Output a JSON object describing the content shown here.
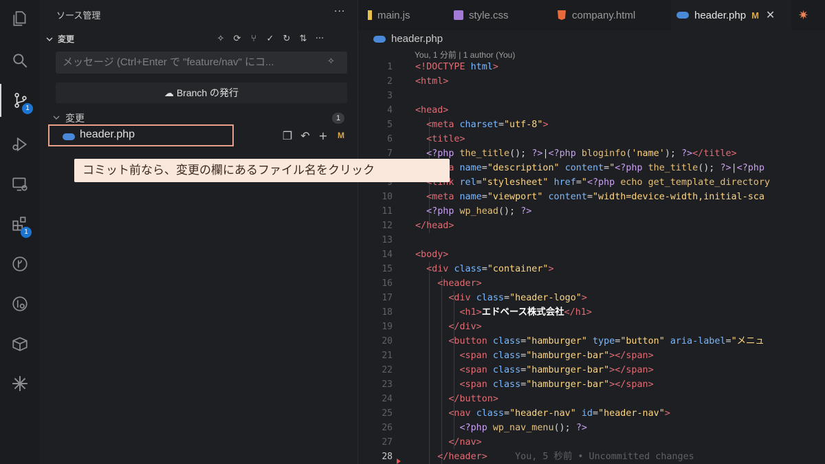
{
  "activity_bar": {
    "items": [
      {
        "name": "explorer-icon"
      },
      {
        "name": "search-icon"
      },
      {
        "name": "source-control-icon",
        "badge": "1"
      },
      {
        "name": "run-debug-icon"
      },
      {
        "name": "remote-explorer-icon"
      },
      {
        "name": "extensions-icon",
        "badge": "1"
      },
      {
        "name": "git-graph-icon"
      },
      {
        "name": "git-lens-icon"
      },
      {
        "name": "box-icon"
      },
      {
        "name": "sparkle-icon"
      }
    ]
  },
  "sidebar": {
    "title": "ソース管理",
    "more": "···",
    "section_label": "変更",
    "commit_message_placeholder": "メッセージ (Ctrl+Enter で \"feature/nav\" にコ...",
    "publish_button": "Branch の発行",
    "changes_label": "変更",
    "changes_count": "1",
    "file_name": "header.php",
    "file_status": "M"
  },
  "callout": {
    "text": "コミット前なら、変更の欄にあるファイル名をクリック"
  },
  "editor": {
    "tabs": [
      {
        "label": "main.js",
        "active": false
      },
      {
        "label": "style.css",
        "active": false
      },
      {
        "label": "company.html",
        "active": false
      },
      {
        "label": "header.php",
        "active": true,
        "modified": "M"
      }
    ],
    "breadcrumb": "header.php",
    "blame_header": "You, 1 分前 | 1 author (You)",
    "line_numbers": [
      "1",
      "2",
      "3",
      "4",
      "5",
      "6",
      "7",
      "8",
      "9",
      "10",
      "11",
      "12",
      "13",
      "14",
      "15",
      "16",
      "17",
      "18",
      "19",
      "20",
      "21",
      "22",
      "23",
      "24",
      "25",
      "26",
      "27",
      "28"
    ],
    "ghost_blame": "You, 5 秒前 • Uncommitted changes",
    "accent": "#d7a94e"
  }
}
